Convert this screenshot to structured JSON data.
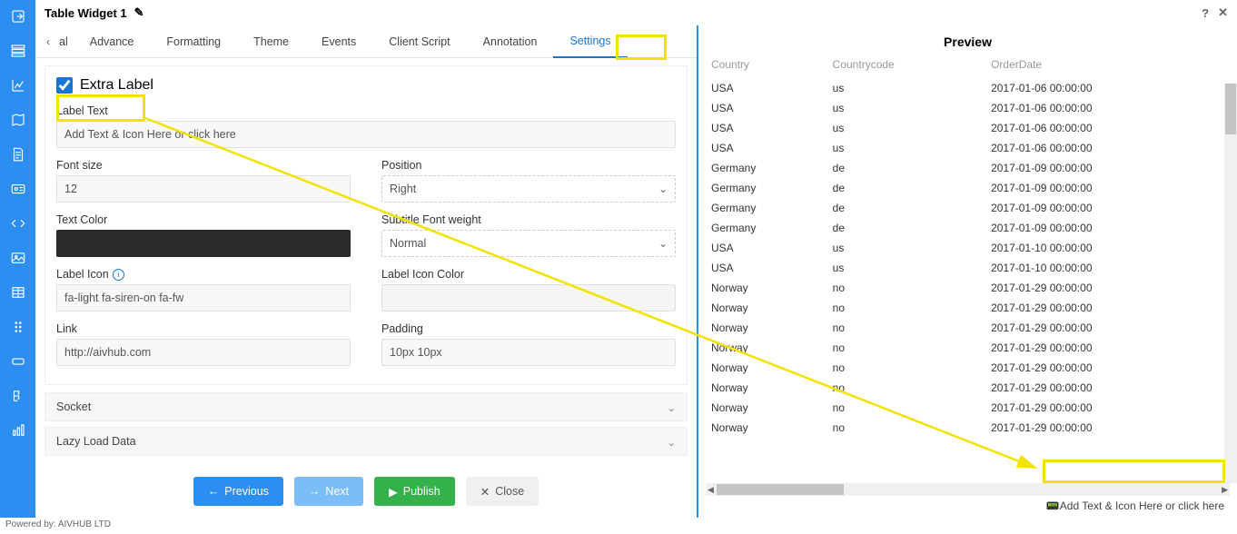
{
  "title": "Table Widget 1",
  "tabs": [
    "al",
    "Advance",
    "Formatting",
    "Theme",
    "Events",
    "Client Script",
    "Annotation",
    "Settings"
  ],
  "active_tab": "Settings",
  "form": {
    "extra_label_checked": true,
    "extra_label": "Extra Label",
    "label_text_label": "Label Text",
    "label_text_value": "Add Text & Icon Here or click here",
    "font_size_label": "Font size",
    "font_size_value": "12",
    "position_label": "Position",
    "position_value": "Right",
    "text_color_label": "Text Color",
    "subtitle_weight_label": "Subtitle Font weight",
    "subtitle_weight_value": "Normal",
    "label_icon_label": "Label Icon",
    "label_icon_value": "fa-light fa-siren-on fa-fw",
    "label_icon_color_label": "Label Icon Color",
    "link_label": "Link",
    "link_value": "http://aivhub.com",
    "padding_label": "Padding",
    "padding_value": "10px 10px"
  },
  "accordions": [
    "Socket",
    "Lazy Load Data"
  ],
  "buttons": {
    "previous": "Previous",
    "next": "Next",
    "publish": "Publish",
    "close": "Close"
  },
  "preview_title": "Preview",
  "preview_footer_label": "Add Text & Icon Here or click here",
  "table": {
    "headers": [
      "Country",
      "Countrycode",
      "OrderDate"
    ],
    "rows": [
      [
        "USA",
        "us",
        "2017-01-06 00:00:00"
      ],
      [
        "USA",
        "us",
        "2017-01-06 00:00:00"
      ],
      [
        "USA",
        "us",
        "2017-01-06 00:00:00"
      ],
      [
        "USA",
        "us",
        "2017-01-06 00:00:00"
      ],
      [
        "Germany",
        "de",
        "2017-01-09 00:00:00"
      ],
      [
        "Germany",
        "de",
        "2017-01-09 00:00:00"
      ],
      [
        "Germany",
        "de",
        "2017-01-09 00:00:00"
      ],
      [
        "Germany",
        "de",
        "2017-01-09 00:00:00"
      ],
      [
        "USA",
        "us",
        "2017-01-10 00:00:00"
      ],
      [
        "USA",
        "us",
        "2017-01-10 00:00:00"
      ],
      [
        "Norway",
        "no",
        "2017-01-29 00:00:00"
      ],
      [
        "Norway",
        "no",
        "2017-01-29 00:00:00"
      ],
      [
        "Norway",
        "no",
        "2017-01-29 00:00:00"
      ],
      [
        "Norway",
        "no",
        "2017-01-29 00:00:00"
      ],
      [
        "Norway",
        "no",
        "2017-01-29 00:00:00"
      ],
      [
        "Norway",
        "no",
        "2017-01-29 00:00:00"
      ],
      [
        "Norway",
        "no",
        "2017-01-29 00:00:00"
      ],
      [
        "Norway",
        "no",
        "2017-01-29 00:00:00"
      ]
    ]
  },
  "footer": "Powered by: AIVHUB LTD"
}
